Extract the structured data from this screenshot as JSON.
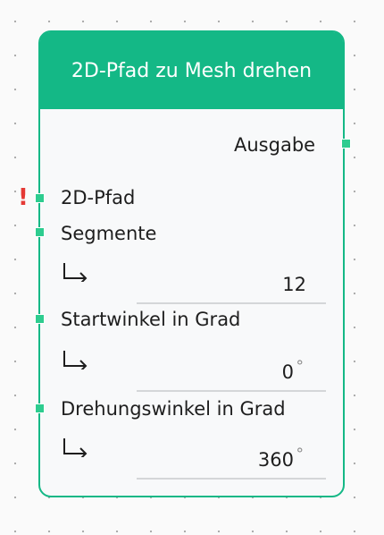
{
  "node": {
    "title": "2D-Pfad zu Mesh drehen",
    "output_label": "Ausgabe",
    "error_indicator": "!",
    "inputs": [
      {
        "label": "2D-Pfad",
        "has_error": true
      },
      {
        "label": "Segmente",
        "value": "12",
        "unit": ""
      },
      {
        "label": "Startwinkel in Grad",
        "value": "0",
        "unit": "°"
      },
      {
        "label": "Drehungswinkel in Grad",
        "value": "360",
        "unit": "°"
      }
    ]
  },
  "colors": {
    "accent": "#14b886",
    "port": "#2ecc8f",
    "error": "#e53935"
  },
  "icons": {
    "value_arrow": "arrow-down-right-icon",
    "error": "exclamation-icon"
  }
}
